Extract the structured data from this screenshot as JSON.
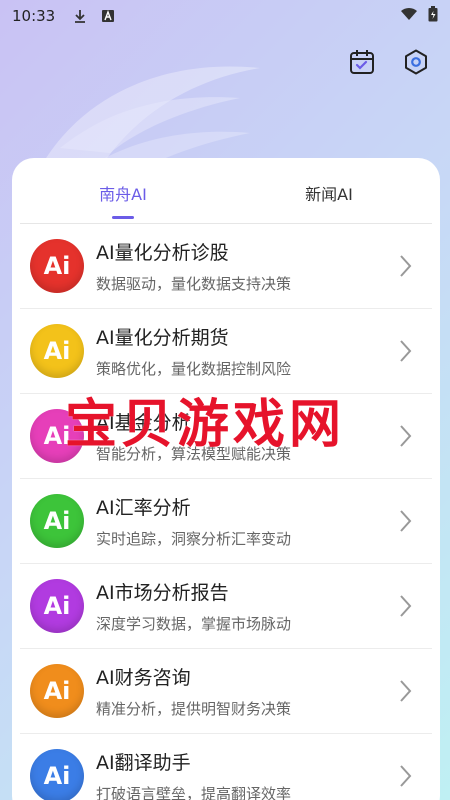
{
  "status_bar": {
    "time": "10:33",
    "icons": [
      "download-icon",
      "keyboard-a-icon",
      "wifi-icon",
      "battery-icon"
    ]
  },
  "header": {
    "actions": [
      {
        "icon": "calendar-check-icon"
      },
      {
        "icon": "settings-hex-icon"
      }
    ]
  },
  "tabs": [
    {
      "label": "南舟AI",
      "active": true
    },
    {
      "label": "新闻AI",
      "active": false
    }
  ],
  "items": [
    {
      "title": "AI量化分析诊股",
      "subtitle": "数据驱动，量化数据支持决策",
      "icon_text": "Ai",
      "color": "#e5322c"
    },
    {
      "title": "AI量化分析期货",
      "subtitle": "策略优化，量化数据控制风险",
      "icon_text": "Ai",
      "color": "#f3c21a"
    },
    {
      "title": "AI基金分析",
      "subtitle": "智能分析，算法模型赋能决策",
      "icon_text": "Ai",
      "color": "#e63fb9"
    },
    {
      "title": "AI汇率分析",
      "subtitle": "实时追踪，洞察分析汇率变动",
      "icon_text": "Ai",
      "color": "#3dc43a"
    },
    {
      "title": "AI市场分析报告",
      "subtitle": "深度学习数据，掌握市场脉动",
      "icon_text": "Ai",
      "color": "#b13be0"
    },
    {
      "title": "AI财务咨询",
      "subtitle": "精准分析，提供明智财务决策",
      "icon_text": "Ai",
      "color": "#f08d1c"
    },
    {
      "title": "AI翻译助手",
      "subtitle": "打破语言壁垒，提高翻译效率",
      "icon_text": "Ai",
      "color": "#3b7de6"
    }
  ],
  "watermark": "宝贝游戏网"
}
